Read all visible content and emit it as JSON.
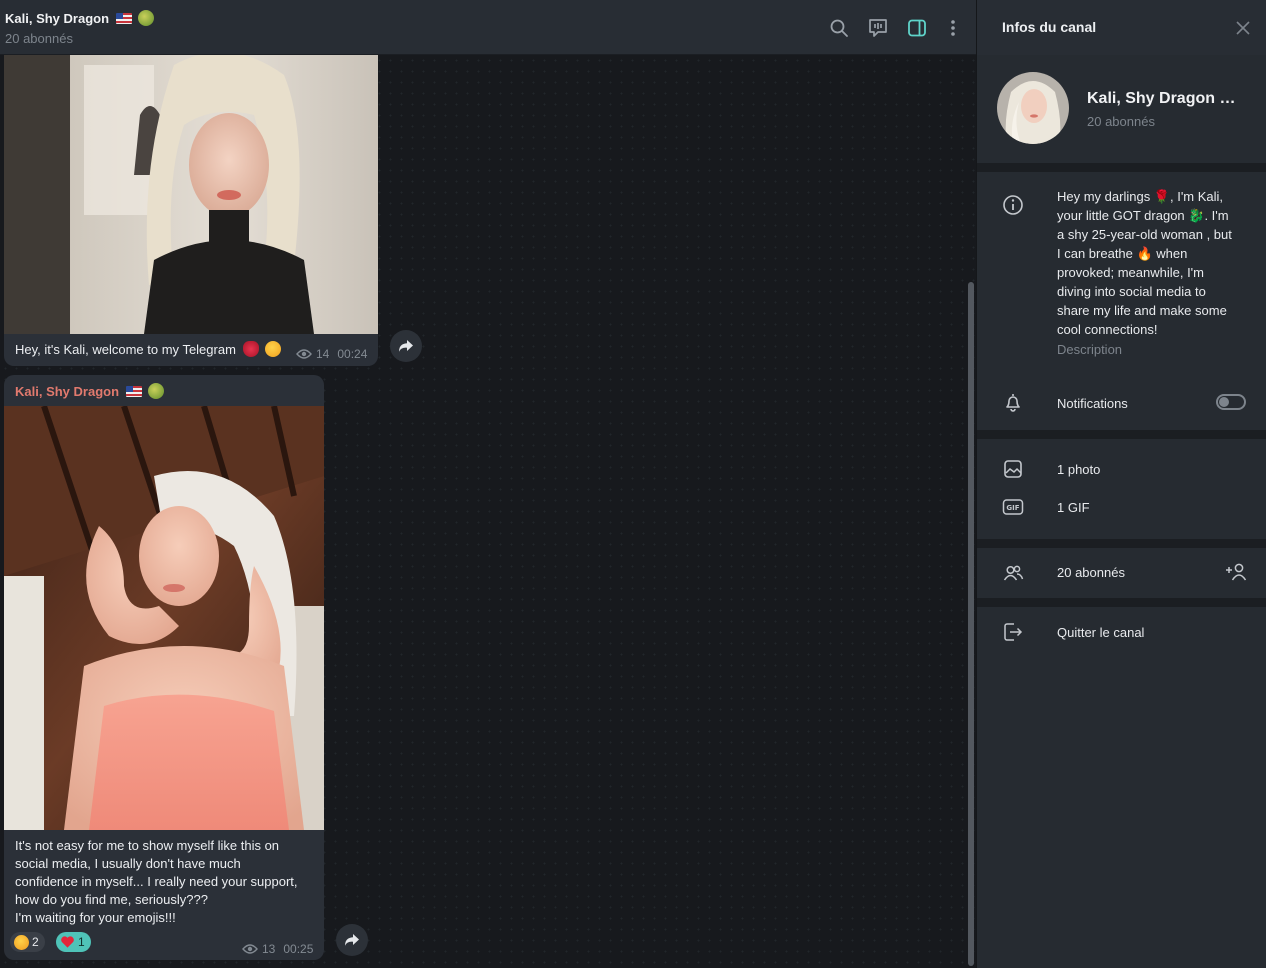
{
  "header": {
    "title": "Kali, Shy Dragon",
    "subtitle": "20 abonnés",
    "icons": [
      "search-icon",
      "live-stream-icon",
      "sidebar-toggle-icon",
      "more-vertical-icon"
    ]
  },
  "messages": [
    {
      "caption": "Hey, it's Kali, welcome to my Telegram",
      "views": "14",
      "time": "00:24"
    },
    {
      "sender": "Kali, Shy Dragon",
      "caption_lines": [
        "It's not easy for me to show myself like this on",
        "social media, I usually don't have much",
        "confidence in myself... I really need your support,",
        "how do you find me, seriously???",
        "I'm waiting for your emojis!!!"
      ],
      "reactions": [
        {
          "emoji": "heart-eyes-emoji",
          "count": "2"
        },
        {
          "emoji": "heart-emoji",
          "count": "1"
        }
      ],
      "views": "13",
      "time": "00:25"
    }
  ],
  "panel": {
    "title": "Infos du canal",
    "profile_name": "Kali, Shy Dragon 🇺🇸...",
    "profile_sub": "20 abonnés",
    "description_lines": [
      "Hey my darlings 🌹, I'm Kali,",
      "your little GOT dragon 🐉. I'm",
      "a shy 25-year-old woman , but",
      "I can breathe 🔥 when",
      "provoked; meanwhile, I'm",
      "diving into social media to",
      "share my life and make some",
      "cool connections!"
    ],
    "description_label": "Description",
    "notifications_label": "Notifications",
    "notifications_on": false,
    "photos_label": "1 photo",
    "gif_label": "1 GIF",
    "subscribers_label": "20 abonnés",
    "leave_label": "Quitter le canal"
  },
  "colors": {
    "accent": "#5fd3c9",
    "sender": "#e27a6e",
    "bubble": "#2b3038",
    "heart_reaction_bg": "#4fc3b8"
  }
}
